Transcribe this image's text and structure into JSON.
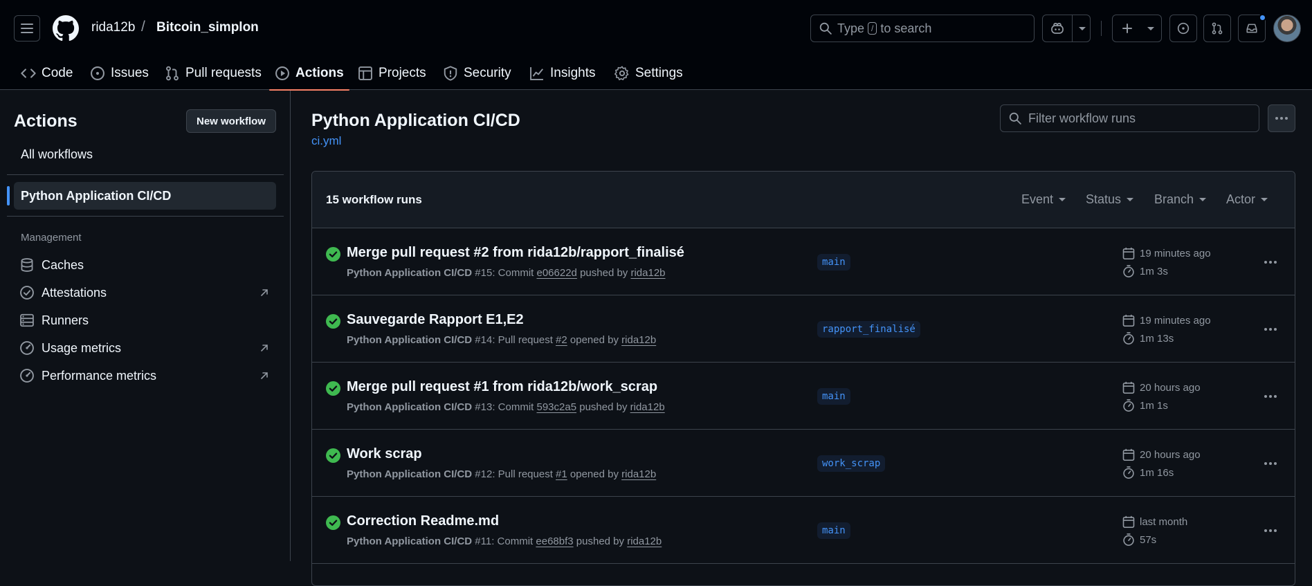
{
  "header": {
    "owner": "rida12b",
    "separator": "/",
    "repo": "Bitcoin_simplon",
    "search": {
      "prefix": "Type",
      "key": "/",
      "suffix": "to search"
    }
  },
  "tabs": [
    {
      "label": "Code",
      "icon": "code-icon"
    },
    {
      "label": "Issues",
      "icon": "issue-icon"
    },
    {
      "label": "Pull requests",
      "icon": "pull-request-icon"
    },
    {
      "label": "Actions",
      "icon": "play-icon",
      "active": true
    },
    {
      "label": "Projects",
      "icon": "table-icon"
    },
    {
      "label": "Security",
      "icon": "shield-icon"
    },
    {
      "label": "Insights",
      "icon": "graph-icon"
    },
    {
      "label": "Settings",
      "icon": "gear-icon"
    }
  ],
  "sidebar": {
    "title": "Actions",
    "new_workflow": "New workflow",
    "all_workflows": "All workflows",
    "active_workflow": "Python Application CI/CD",
    "management_heading": "Management",
    "management_items": [
      {
        "label": "Caches",
        "icon": "database-icon"
      },
      {
        "label": "Attestations",
        "icon": "verified-icon",
        "external": true
      },
      {
        "label": "Runners",
        "icon": "server-icon"
      },
      {
        "label": "Usage metrics",
        "icon": "meter-icon",
        "external": true
      },
      {
        "label": "Performance metrics",
        "icon": "meter-icon",
        "external": true
      }
    ]
  },
  "main": {
    "title": "Python Application CI/CD",
    "file": "ci.yml",
    "filter_placeholder": "Filter workflow runs",
    "runs_count": "15 workflow runs",
    "filters": [
      "Event",
      "Status",
      "Branch",
      "Actor"
    ],
    "runs": [
      {
        "title": "Merge pull request #2 from rida12b/rapport_finalisé",
        "workflow": "Python Application CI/CD",
        "number": "#15",
        "action": "Commit",
        "ref": "e06622d",
        "verb": "pushed by",
        "user": "rida12b",
        "branch": "main",
        "when": "19 minutes ago",
        "duration": "1m 3s"
      },
      {
        "title": "Sauvegarde Rapport E1,E2",
        "workflow": "Python Application CI/CD",
        "number": "#14",
        "action": "Pull request",
        "ref": "#2",
        "verb": "opened by",
        "user": "rida12b",
        "branch": "rapport_finalisé",
        "when": "19 minutes ago",
        "duration": "1m 13s"
      },
      {
        "title": "Merge pull request #1 from rida12b/work_scrap",
        "workflow": "Python Application CI/CD",
        "number": "#13",
        "action": "Commit",
        "ref": "593c2a5",
        "verb": "pushed by",
        "user": "rida12b",
        "branch": "main",
        "when": "20 hours ago",
        "duration": "1m 1s"
      },
      {
        "title": "Work scrap",
        "workflow": "Python Application CI/CD",
        "number": "#12",
        "action": "Pull request",
        "ref": "#1",
        "verb": "opened by",
        "user": "rida12b",
        "branch": "work_scrap",
        "when": "20 hours ago",
        "duration": "1m 16s"
      },
      {
        "title": "Correction Readme.md",
        "workflow": "Python Application CI/CD",
        "number": "#11",
        "action": "Commit",
        "ref": "ee68bf3",
        "verb": "pushed by",
        "user": "rida12b",
        "branch": "main",
        "when": "last month",
        "duration": "57s"
      }
    ]
  },
  "colors": {
    "accent": "#4493f8",
    "success": "#3fb950",
    "tab_underline": "#f78166"
  }
}
